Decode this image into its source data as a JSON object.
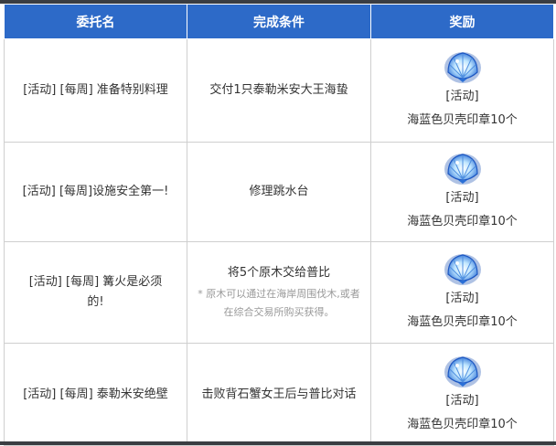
{
  "header": {
    "col1": "委托名",
    "col2": "完成条件",
    "col3": "奖励"
  },
  "rows": [
    {
      "name": "[活动] [每周] 准备特别料理",
      "condition": "交付1只泰勒米安大王海蛰",
      "note": "",
      "reward_icon": "seashell-seal-icon",
      "reward_tag": "[活动]",
      "reward_item": "海蓝色贝壳印章10个"
    },
    {
      "name": "[活动] [每周]设施安全第一!",
      "condition": "修理跳水台",
      "note": "",
      "reward_icon": "seashell-seal-icon",
      "reward_tag": "[活动]",
      "reward_item": "海蓝色贝壳印章10个"
    },
    {
      "name": "[活动] [每周] 篝火是必须的!",
      "condition": "将5个原木交给普比",
      "note": "* 原木可以通过在海岸周围伐木,或者在综合交易所购买获得。",
      "reward_icon": "seashell-seal-icon",
      "reward_tag": "[活动]",
      "reward_item": "海蓝色贝壳印章10个"
    },
    {
      "name": "[活动] [每周] 泰勒米安绝壁",
      "condition": "击败背石蟹女王后与普比对话",
      "note": "",
      "reward_icon": "seashell-seal-icon",
      "reward_tag": "[活动]",
      "reward_item": "海蓝色贝壳印章10个"
    }
  ],
  "colors": {
    "header_bg": "#2d6ac8",
    "header_text": "#ffffff",
    "border": "#cfcfcf",
    "note_text": "#999999",
    "frame": "#3a3d42"
  }
}
